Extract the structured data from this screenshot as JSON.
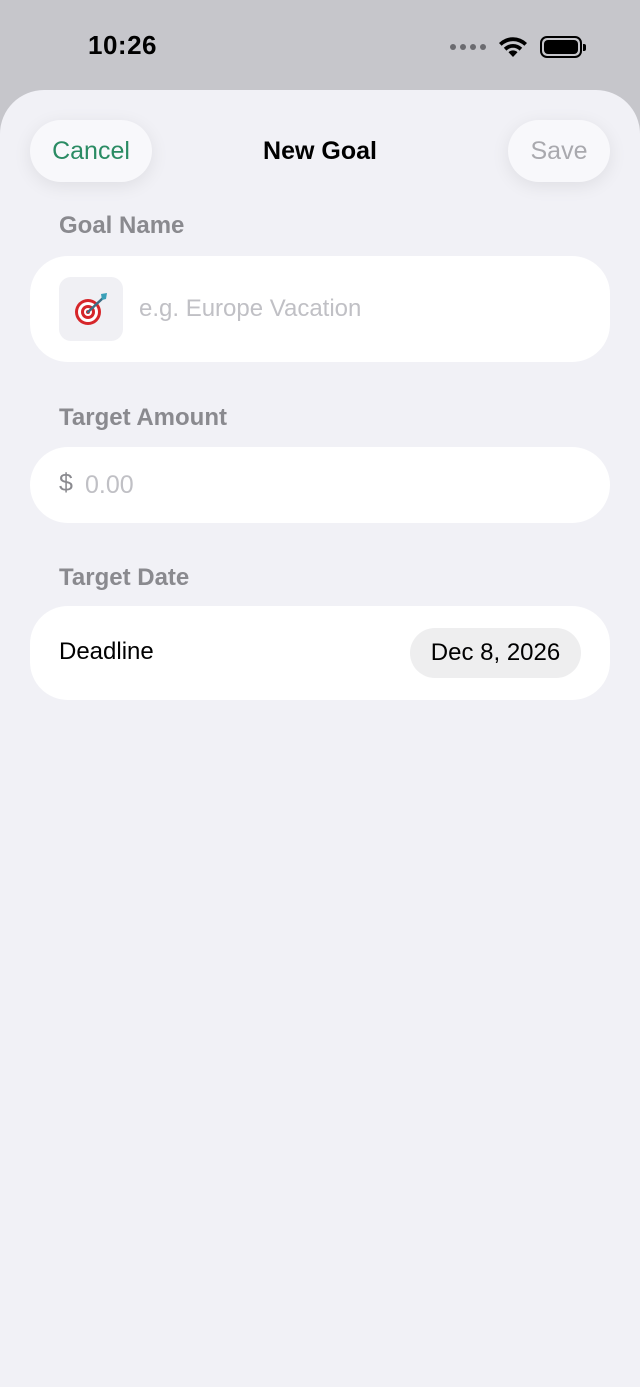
{
  "status_bar": {
    "time": "10:26",
    "icons": [
      "signal-dots-icon",
      "wifi-icon",
      "battery-icon"
    ]
  },
  "nav": {
    "cancel_label": "Cancel",
    "title": "New Goal",
    "save_label": "Save"
  },
  "goal_name": {
    "section_label": "Goal Name",
    "emoji": "🎯",
    "placeholder": "e.g. Europe Vacation",
    "value": ""
  },
  "target_amount": {
    "section_label": "Target Amount",
    "currency_symbol": "$",
    "placeholder": "0.00",
    "value": ""
  },
  "target_date": {
    "section_label": "Target Date",
    "deadline_label": "Deadline",
    "date_value": "Dec 8, 2026"
  },
  "colors": {
    "accent": "#2a8b63",
    "background": "#f1f1f6",
    "card": "#ffffff",
    "secondary_text": "#8a8a8f",
    "disabled_text": "#a9a9ae"
  }
}
